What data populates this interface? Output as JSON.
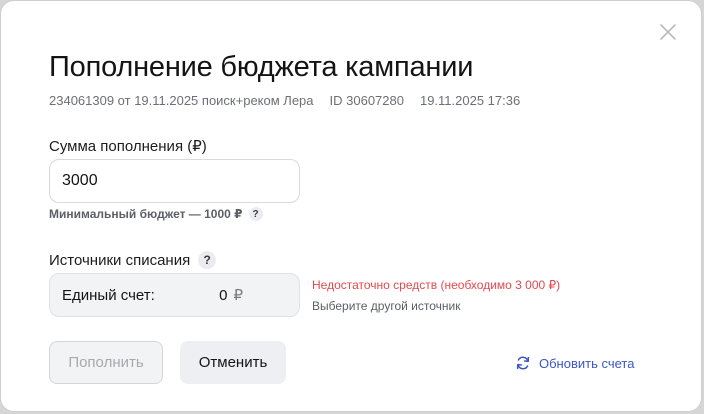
{
  "dialog": {
    "title": "Пополнение бюджета кампании",
    "meta": {
      "campaign": "234061309 от 19.11.2025 поиск+реком Лера",
      "id": "ID 30607280",
      "datetime": "19.11.2025 17:36"
    }
  },
  "amount": {
    "label": "Сумма пополнения (₽)",
    "value": "3000",
    "hint": "Минимальный бюджет — 1000 ₽",
    "hint_icon": "?"
  },
  "sources": {
    "label": "Источники списания",
    "help_icon": "?",
    "account_name": "Единый счет:",
    "account_amount": "0",
    "account_currency": "₽",
    "error": "Недостаточно средств (необходимо 3 000 ₽)",
    "sub": "Выберите другой источник"
  },
  "actions": {
    "submit": "Пополнить",
    "cancel": "Отменить",
    "refresh": "Обновить счета"
  },
  "colors": {
    "error": "#e5484d",
    "link": "#3a57c4"
  }
}
